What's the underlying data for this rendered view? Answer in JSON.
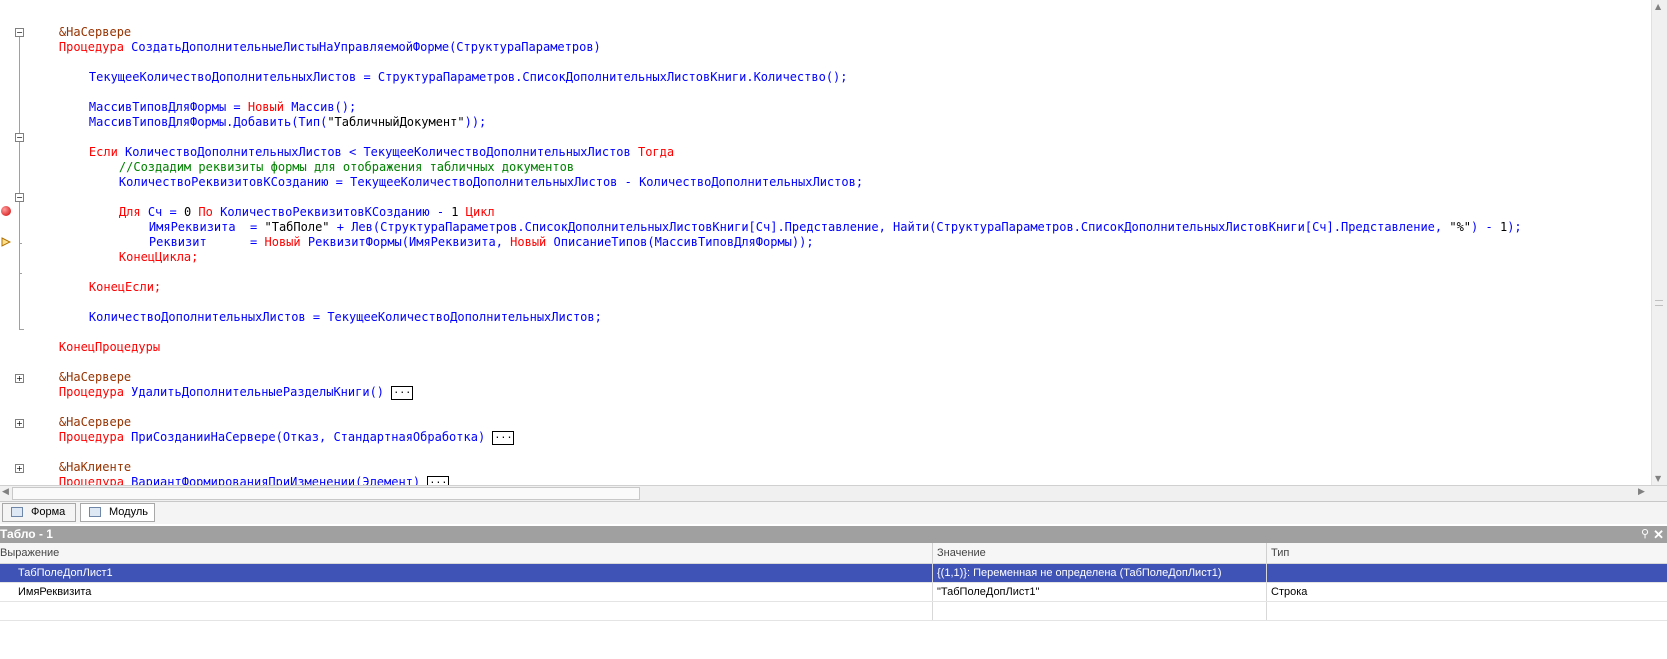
{
  "editor": {
    "lines": {
      "l1_dir": "&НаСервере",
      "l2_kw": "Процедура",
      "l2_name": "СоздатьДополнительныеЛистыНаУправляемойФорме",
      "l2_args": "(СтруктураПараметров)",
      "l4": "ТекущееКоличествоДополнительныхЛистов = СтруктураПараметров.СписокДополнительныхЛистовКниги.Количество();",
      "l6_a": "МассивТиповДляФормы = ",
      "l6_kw": "Новый",
      "l6_b": " Массив();",
      "l7_a": "МассивТиповДляФормы.Добавить(Тип(",
      "l7_str": "\"ТабличныйДокумент\"",
      "l7_b": "));",
      "l9_kw1": "Если",
      "l9_a": " КоличествоДополнительныхЛистов < ТекущееКоличествоДополнительныхЛистов ",
      "l9_kw2": "Тогда",
      "l10_comment": "//Создадим реквизиты формы для отображения табличных документов",
      "l11": "КоличествоРеквизитовКСозданию = ТекущееКоличествоДополнительныхЛистов - КоличествоДополнительныхЛистов;",
      "l13_kw1": "Для",
      "l13_a": " Сч = ",
      "l13_n0": "0",
      "l13_kw2": " По",
      "l13_b": " КоличествоРеквизитовКСозданию - ",
      "l13_n1": "1",
      "l13_kw3": " Цикл",
      "l14_a": "ИмяРеквизита  = ",
      "l14_str": "\"ТабПоле\"",
      "l14_b": " + Лев(СтруктураПараметров.СписокДополнительныхЛистовКниги[Сч].Представление, Найти(СтруктураПараметров.СписокДополнительныхЛистовКниги[Сч].Представление, ",
      "l14_str2": "\"%\"",
      "l14_c": ") - ",
      "l14_n": "1",
      "l14_d": ");",
      "l15_a": "Реквизит      = ",
      "l15_kw1": "Новый",
      "l15_b": " РеквизитФормы(ИмяРеквизита, ",
      "l15_kw2": "Новый",
      "l15_c": " ОписаниеТипов(МассивТиповДляФормы));",
      "l16_kw": "КонецЦикла;",
      "l18_kw": "КонецЕсли;",
      "l20": "КоличествоДополнительныхЛистов = ТекущееКоличествоДополнительныхЛистов;",
      "l22_kw": "КонецПроцедуры",
      "l24_dir": "&НаСервере",
      "l25_kw": "Процедура",
      "l25_name": " УдалитьДополнительныеРазделыКниги()",
      "l27_dir": "&НаСервере",
      "l28_kw": "Процедура",
      "l28_name": " ПриСозданииНаСервере(Отказ, СтандартнаяОбработка)",
      "l30_dir": "&НаКлиенте",
      "l31_kw": "Процедура",
      "l31_name": " ВариантФормированияПриИзменении(Элемент)",
      "collapsed_marker": "..."
    }
  },
  "tabs": [
    {
      "label": "Форма"
    },
    {
      "label": "Модуль"
    }
  ],
  "watch": {
    "title": "Табло - 1",
    "pin": "⚲",
    "close": "✕",
    "columns": [
      "Выражение",
      "Значение",
      "Тип"
    ],
    "rows": [
      {
        "expr": "ТабПолеДопЛист1",
        "value": "{(1,1)}: Переменная не определена (ТабПолеДопЛист1)",
        "type": ""
      },
      {
        "expr": "ИмяРеквизита",
        "value": "\"ТабПолеДопЛист1\"",
        "type": "Строка"
      }
    ]
  },
  "colors": {
    "keyword": "#ff0000",
    "identifier": "#0000ff",
    "comment": "#008000",
    "directive": "#963200",
    "selection": "#3f52b5"
  }
}
